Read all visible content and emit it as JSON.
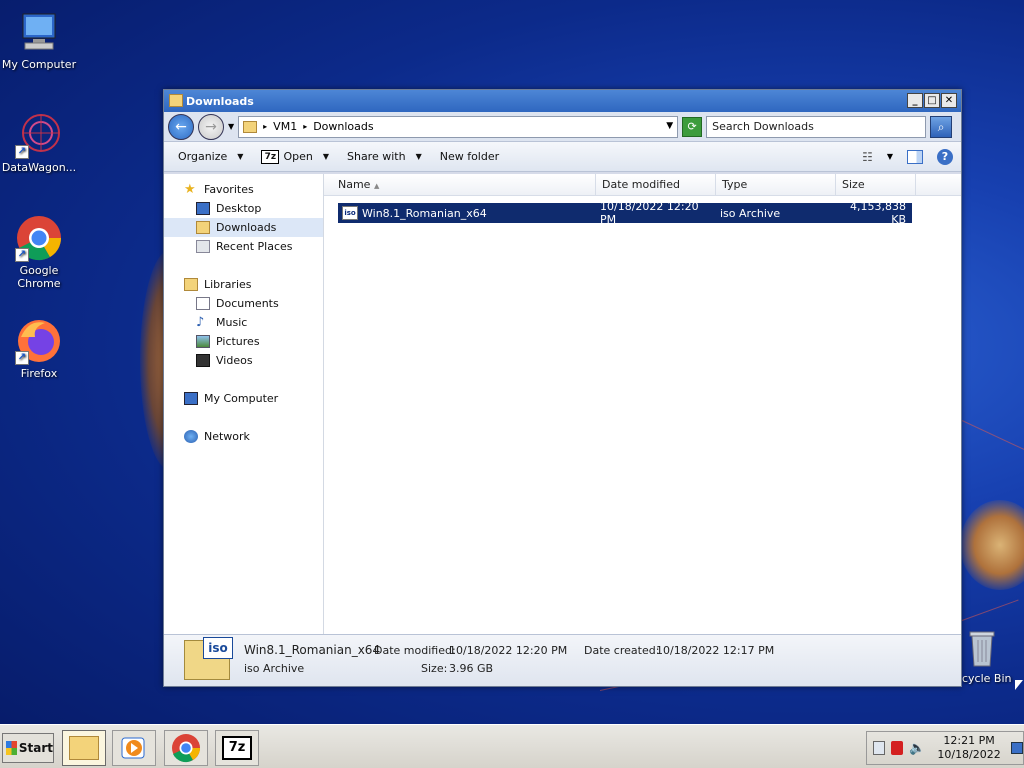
{
  "desktop": {
    "icons": [
      {
        "label": "My Computer"
      },
      {
        "label": "DataWagon..."
      },
      {
        "label": "Google Chrome"
      },
      {
        "label": "Firefox"
      },
      {
        "label": "cycle Bin"
      }
    ]
  },
  "window": {
    "title": "Downloads",
    "address": {
      "crumbs": [
        "VM1",
        "Downloads"
      ],
      "separator": "▸"
    },
    "search_placeholder": "Search Downloads",
    "toolbar": {
      "organize": "Organize",
      "open": "Open",
      "open_icon_text": "7z",
      "share_with": "Share with",
      "new_folder": "New folder"
    },
    "nav": {
      "favorites": "Favorites",
      "desktop": "Desktop",
      "downloads": "Downloads",
      "recent_places": "Recent Places",
      "libraries": "Libraries",
      "documents": "Documents",
      "music": "Music",
      "pictures": "Pictures",
      "videos": "Videos",
      "my_computer": "My Computer",
      "network": "Network"
    },
    "columns": [
      "Name",
      "Date modified",
      "Type",
      "Size"
    ],
    "files": [
      {
        "name": "Win8.1_Romanian_x64",
        "date_modified": "10/18/2022 12:20 PM",
        "type": "iso Archive",
        "size": "4,153,838 KB",
        "icon_text": "iso"
      }
    ],
    "details": {
      "icon_text": "iso",
      "name": "Win8.1_Romanian_x64",
      "type": "iso Archive",
      "date_modified_label": "Date modified:",
      "date_modified": "10/18/2022 12:20 PM",
      "date_created_label": "Date created:",
      "date_created": "10/18/2022 12:17 PM",
      "size_label": "Size:",
      "size": "3.96 GB"
    }
  },
  "taskbar": {
    "start": "Start",
    "zip_label": "7z",
    "clock_time": "12:21 PM",
    "clock_date": "10/18/2022"
  },
  "colors": {
    "selection": "#0f2b6e",
    "titlebar": "#3a73c8"
  }
}
